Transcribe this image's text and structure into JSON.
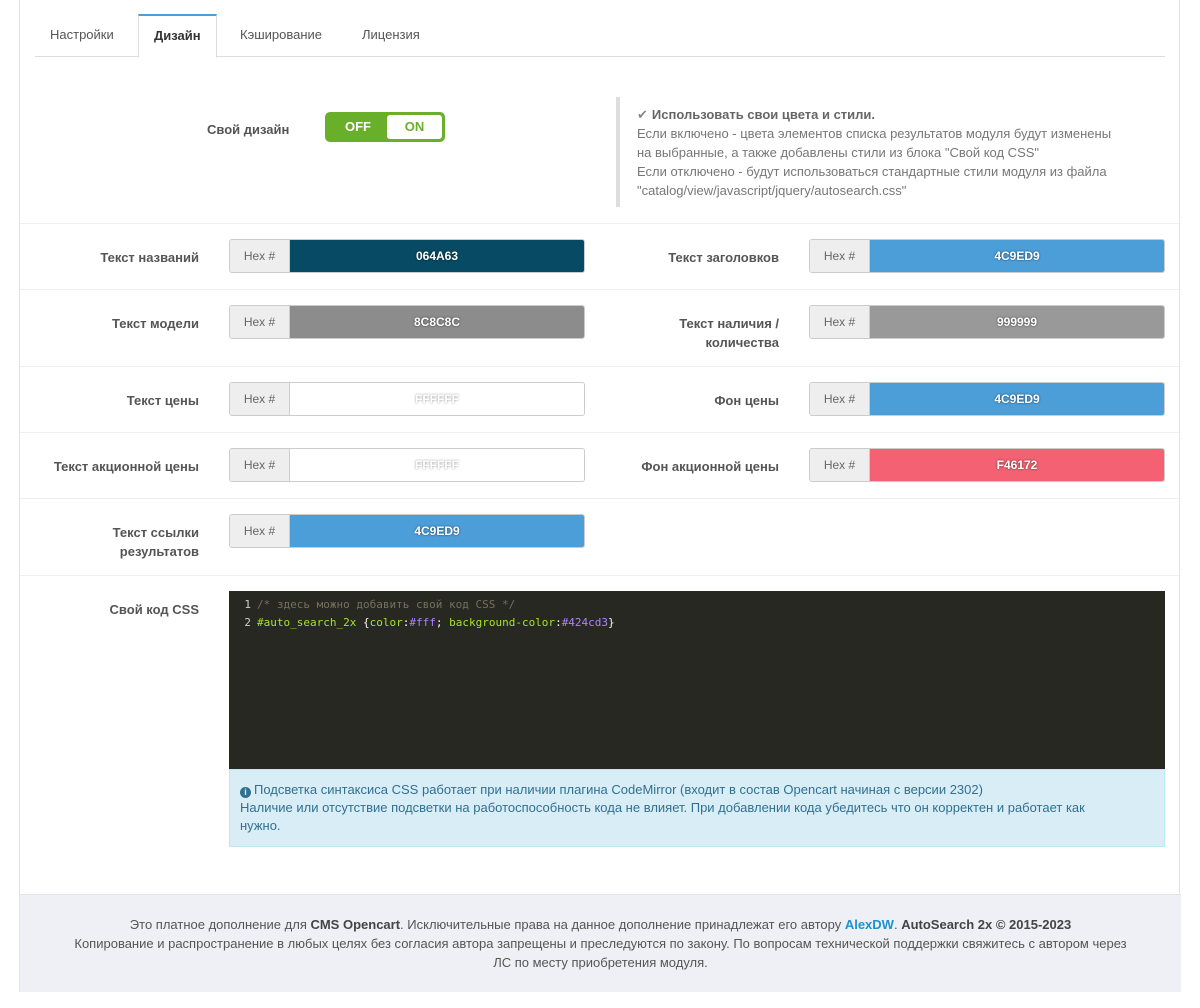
{
  "tabs": [
    {
      "label": "Настройки"
    },
    {
      "label": "Дизайн"
    },
    {
      "label": "Кэширование"
    },
    {
      "label": "Лицензия"
    }
  ],
  "design_switch": {
    "label": "Свой дизайн",
    "off_label": "OFF",
    "on_label": "ON",
    "state": "on"
  },
  "help": {
    "title": "Использовать свои цвета и стили.",
    "line1": "Если включено - цвета элементов списка результатов модуля будут изменены",
    "line2": "на выбранные, а также добавлены стили из блока \"Свой код CSS\"",
    "line3": "Если отключено - будут использоваться стандартные стили модуля из файла",
    "line4": "\"catalog/view/javascript/jquery/autosearch.css\""
  },
  "addon_label": "Hex #",
  "colors": {
    "names_text": {
      "label": "Текст названий",
      "value": "064A63",
      "color": "#064a63"
    },
    "headers_text": {
      "label": "Текст заголовков",
      "value": "4C9ED9",
      "color": "#4c9ed9"
    },
    "model_text": {
      "label": "Текст модели",
      "value": "8C8C8C",
      "color": "#8c8c8c"
    },
    "stock_text": {
      "label_line1": "Текст наличия /",
      "label_line2": "количества",
      "value": "999999",
      "color": "#999999"
    },
    "price_text": {
      "label": "Текст цены",
      "value": "FFFFFF",
      "color": "#ffffff"
    },
    "price_bg": {
      "label": "Фон цены",
      "value": "4C9ED9",
      "color": "#4c9ed9"
    },
    "special_price_text": {
      "label": "Текст акционной цены",
      "value": "FFFFFF",
      "color": "#ffffff"
    },
    "special_price_bg": {
      "label": "Фон акционной цены",
      "value": "F46172",
      "color": "#f46172"
    },
    "link_text": {
      "label_line1": "Текст ссылки",
      "label_line2": "результатов",
      "value": "4C9ED9",
      "color": "#4c9ed9"
    }
  },
  "css_code": {
    "label": "Свой код CSS",
    "line1_num": "1",
    "line1": "/* здесь можно добавить свой код CSS */",
    "line2_num": "2",
    "line2_selector": "#auto_search_2x",
    "line2_open": " {",
    "line2_prop1": "color",
    "line2_colon1": ":",
    "line2_val1": "#fff",
    "line2_sep": "; ",
    "line2_prop2": "background-color",
    "line2_colon2": ":",
    "line2_val2": "#424cd3",
    "line2_close": "}"
  },
  "info": {
    "line1": "Подсветка синтаксиса CSS работает при наличии плагина CodeMirror (входит в состав Opencart начиная с версии 2302)",
    "line2": "Наличие или отсутствие подсветки на работоспособность кода не влияет. При добавлении кода убедитесь что он корректен и работает как",
    "line3": "нужно."
  },
  "footer": {
    "t1": "Это платное дополнение для ",
    "cms": "CMS Opencart",
    "t2": ". Исключительные права на данное дополнение принадлежат его автору ",
    "author": "AlexDW",
    "t3": ". ",
    "product": "AutoSearch 2x © 2015-2023",
    "line2": "Копирование и распространение в любых целях без согласия автора запрещены и преследуются по закону. По вопросам технической поддержки свяжитесь с автором через",
    "line3": "ЛС по месту приобретения модуля."
  }
}
